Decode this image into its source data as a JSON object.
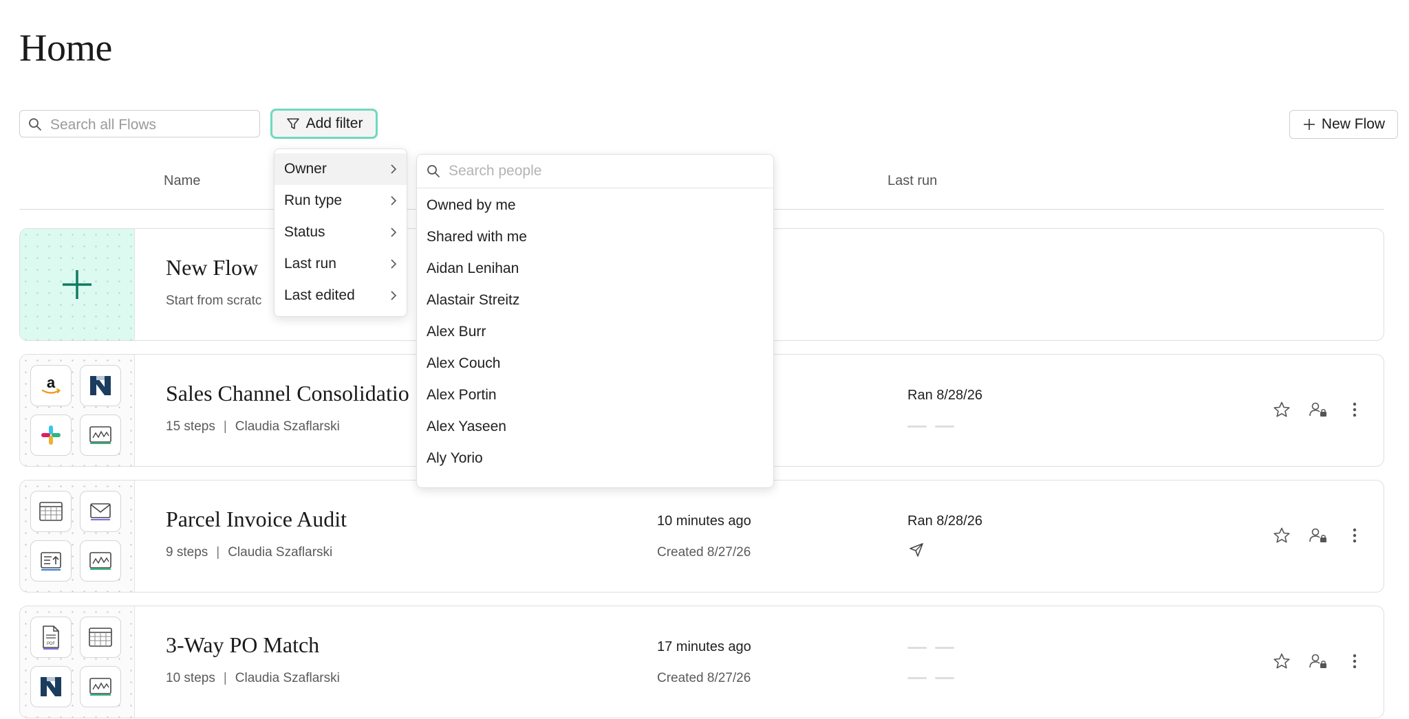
{
  "page": {
    "title": "Home"
  },
  "toolbar": {
    "search_placeholder": "Search all Flows",
    "add_filter_label": "Add filter",
    "new_flow_label": "New Flow"
  },
  "columns": {
    "name": "Name",
    "last_run": "Last run"
  },
  "new_flow_card": {
    "title": "New Flow",
    "subtitle": "Start from scratc"
  },
  "flows": [
    {
      "title": "Sales Channel Consolidatio",
      "steps": "15 steps",
      "owner": "Claudia Szaflarski",
      "last_run": "Ran 8/28/26",
      "icons": [
        "amazon-icon",
        "netsuite-icon",
        "slack-icon",
        "dashboard-icon"
      ]
    },
    {
      "title": "Parcel Invoice Audit",
      "steps": "9 steps",
      "owner": "Claudia Szaflarski",
      "modified": "10 minutes ago",
      "created": "Created 8/27/26",
      "last_run": "Ran 8/28/26",
      "icons": [
        "spreadsheet-icon",
        "email-icon",
        "upload-report-icon",
        "dashboard-icon"
      ]
    },
    {
      "title": "3-Way PO Match",
      "steps": "10 steps",
      "owner": "Claudia Szaflarski",
      "modified": "17 minutes ago",
      "created": "Created 8/27/26",
      "icons": [
        "pdf-icon",
        "spreadsheet-icon",
        "netsuite-icon",
        "dashboard-icon"
      ]
    }
  ],
  "filter_menu": {
    "items": [
      "Owner",
      "Run type",
      "Status",
      "Last run",
      "Last edited"
    ],
    "active": "Owner"
  },
  "people_menu": {
    "search_placeholder": "Search people",
    "items": [
      "Owned by me",
      "Shared with me",
      "Aidan Lenihan",
      "Alastair Streitz",
      "Alex Burr",
      "Alex Couch",
      "Alex Portin",
      "Alex Yaseen",
      "Aly Yorio"
    ]
  },
  "colors": {
    "accent": "#6fd9bd",
    "new_flow_bg": "#dcfaf0",
    "plus": "#0f7a62"
  }
}
